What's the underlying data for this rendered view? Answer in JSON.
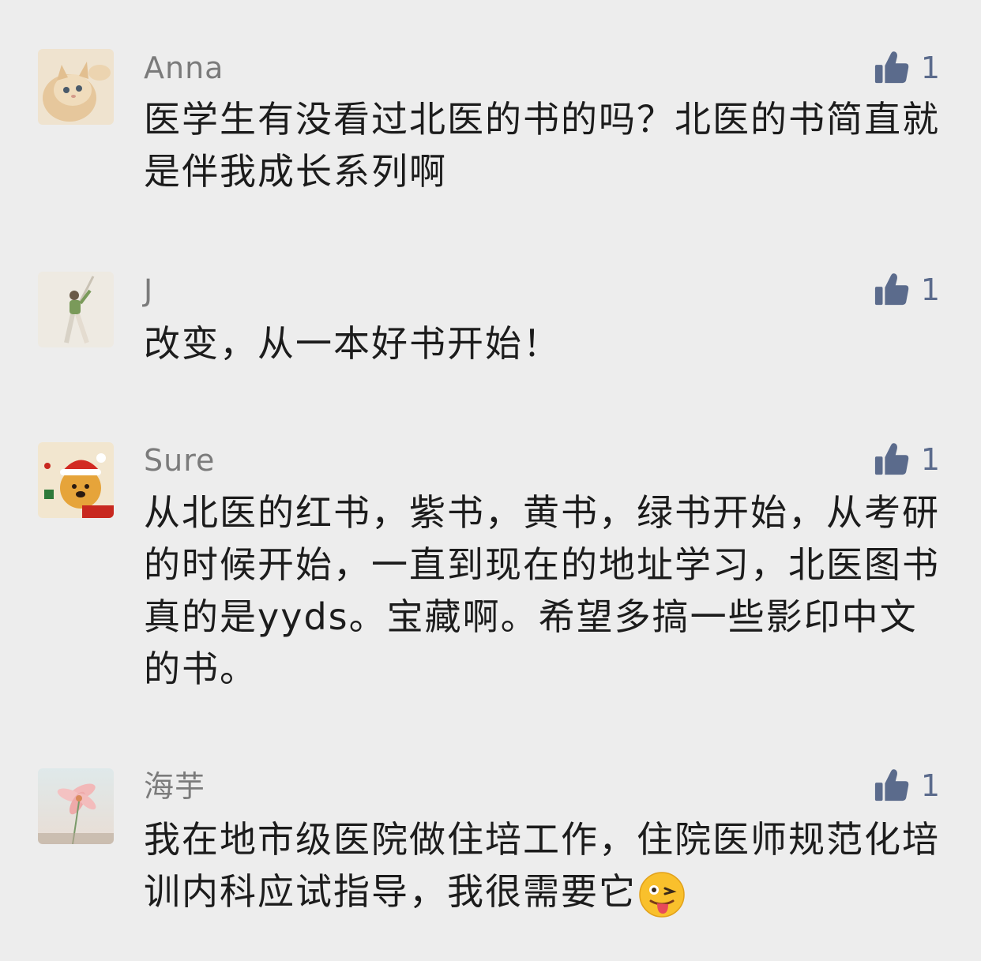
{
  "colors": {
    "background": "#ededed",
    "username": "#7b7b7b",
    "text": "#1c1c1c",
    "like": "#5b6b8c"
  },
  "icons": {
    "like": "thumbs-up-icon",
    "emoji": "winking-face-with-tongue-icon"
  },
  "comments": [
    {
      "username": "Anna",
      "like_count": "1",
      "text": "医学生有没看过北医的书的吗？北医的书简直就是伴我成长系列啊"
    },
    {
      "username": "J",
      "like_count": "1",
      "text": "改变，从一本好书开始！"
    },
    {
      "username": "Sure",
      "like_count": "1",
      "text": "从北医的红书，紫书，黄书，绿书开始，从考研的时候开始，一直到现在的地址学习，北医图书真的是yyds。宝藏啊。希望多搞一些影印中文的书。"
    },
    {
      "username": "海芋",
      "like_count": "1",
      "text": "我在地市级医院做住培工作，住院医师规范化培训内科应试指导，我很需要它"
    }
  ]
}
